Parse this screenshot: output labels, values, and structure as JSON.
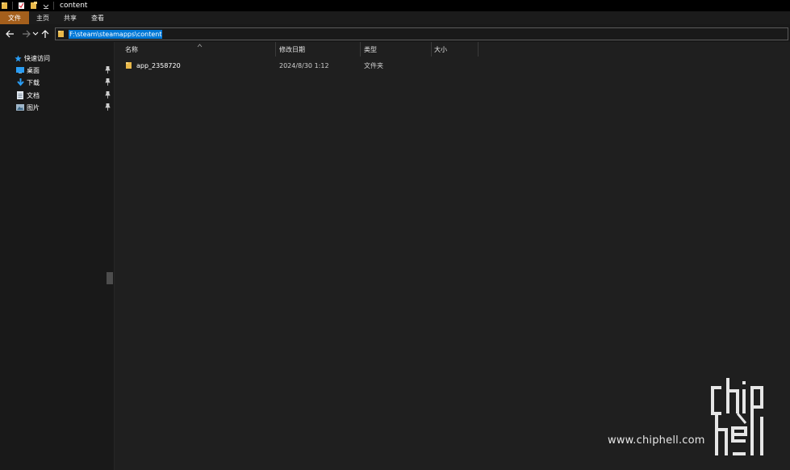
{
  "window": {
    "title": "content"
  },
  "quick_access_icons": [
    "folder-icon",
    "properties-icon",
    "new-folder-icon",
    "dropdown-arrow-icon"
  ],
  "ribbon": {
    "tabs": [
      {
        "label": "文件",
        "active": true
      },
      {
        "label": "主页"
      },
      {
        "label": "共享"
      },
      {
        "label": "查看"
      }
    ]
  },
  "address": {
    "path": "F:\\steam\\steamapps\\content"
  },
  "nav": {
    "quick_access_label": "快速访问",
    "items": [
      {
        "label": "桌面",
        "icon": "desktop-icon",
        "pinned": true
      },
      {
        "label": "下载",
        "icon": "download-icon",
        "pinned": true
      },
      {
        "label": "文档",
        "icon": "document-icon",
        "pinned": true
      },
      {
        "label": "图片",
        "icon": "pictures-icon",
        "pinned": true
      }
    ]
  },
  "list": {
    "columns": [
      "名称",
      "修改日期",
      "类型",
      "大小"
    ],
    "rows": [
      {
        "name": "app_2358720",
        "modified": "2024/8/30 1:12",
        "type": "文件夹",
        "size": ""
      }
    ]
  },
  "colors": {
    "file_tab": "#a45f1c",
    "selection": "#0078d7",
    "folder": "#e8b84a",
    "star": "#2a9df4"
  },
  "watermark": {
    "url": "www.chiphell.com",
    "logo_text": "chiphell"
  }
}
